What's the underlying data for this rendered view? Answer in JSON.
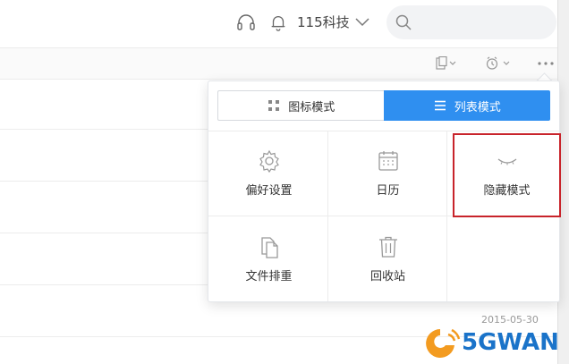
{
  "header": {
    "user_name": "115科技",
    "search_placeholder": ""
  },
  "menu": {
    "modes": [
      {
        "label": "图标模式",
        "icon": "grid-icon",
        "active": false
      },
      {
        "label": "列表模式",
        "icon": "list-icon",
        "active": true
      }
    ],
    "items": [
      {
        "label": "偏好设置",
        "icon": "gear-icon"
      },
      {
        "label": "日历",
        "icon": "calendar-icon"
      },
      {
        "label": "隐藏模式",
        "icon": "closed-eye-icon",
        "highlighted": true
      },
      {
        "label": "文件排重",
        "icon": "duplicate-file-icon"
      },
      {
        "label": "回收站",
        "icon": "trash-icon"
      }
    ]
  },
  "file_list": {
    "rows": [
      {
        "date": "2015-05-30"
      }
    ]
  },
  "watermark": {
    "text": "5GWAN"
  },
  "colors": {
    "accent": "#2f8ff0",
    "highlight_border": "#c8242b",
    "watermark": "#1a73c9"
  }
}
